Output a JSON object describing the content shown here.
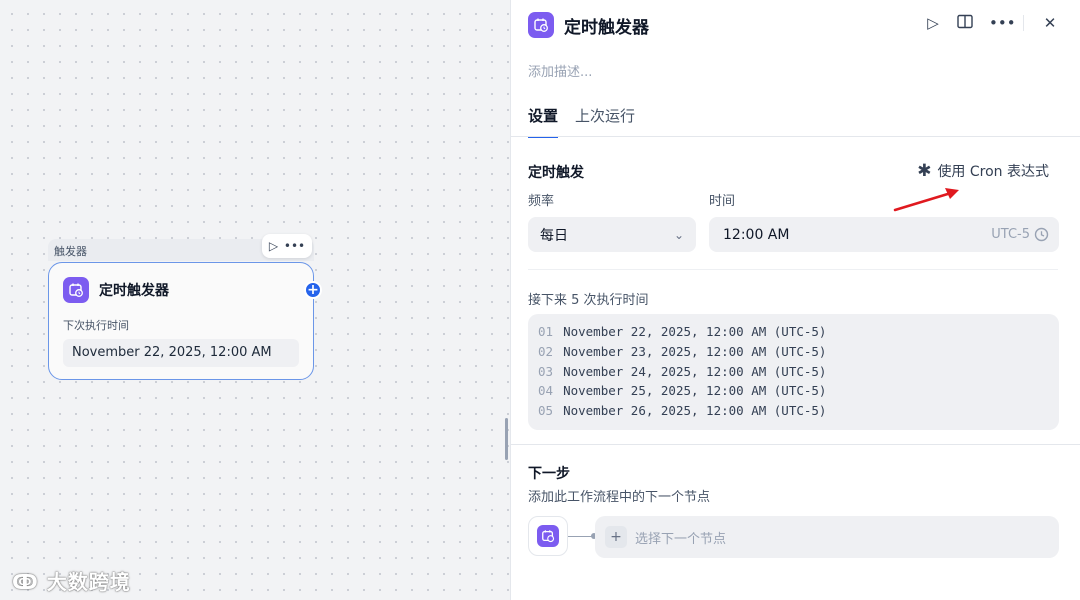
{
  "canvas": {
    "node": {
      "tag": "触发器",
      "title": "定时触发器",
      "next_run_label": "下次执行时间",
      "next_run_value": "November 22, 2025, 12:00 AM",
      "run_icon": "play-icon",
      "more_icon": "more-icon"
    },
    "watermark": "大数跨境"
  },
  "panel": {
    "title": "定时触发器",
    "description_placeholder": "添加描述...",
    "tools": [
      "play-icon",
      "book-icon",
      "more-icon",
      "close-icon"
    ],
    "tabs": [
      {
        "label": "设置",
        "active": true
      },
      {
        "label": "上次运行",
        "active": false
      }
    ],
    "schedule": {
      "title": "定时触发",
      "cron_toggle": "使用 Cron 表达式",
      "frequency_label": "频率",
      "frequency_value": "每日",
      "time_label": "时间",
      "time_value": "12:00 AM",
      "timezone": "UTC-5"
    },
    "next_runs": {
      "label": "接下来 5 次执行时间",
      "items": [
        {
          "index": "01",
          "value": "November 22, 2025, 12:00 AM (UTC-5)"
        },
        {
          "index": "02",
          "value": "November 23, 2025, 12:00 AM (UTC-5)"
        },
        {
          "index": "03",
          "value": "November 24, 2025, 12:00 AM (UTC-5)"
        },
        {
          "index": "04",
          "value": "November 25, 2025, 12:00 AM (UTC-5)"
        },
        {
          "index": "05",
          "value": "November 26, 2025, 12:00 AM (UTC-5)"
        }
      ]
    },
    "next_step": {
      "title": "下一步",
      "subtitle": "添加此工作流程中的下一个节点",
      "select_label": "选择下一个节点"
    }
  },
  "colors": {
    "accent": "#2563eb",
    "app_icon": "#7c5cf0",
    "annotation_arrow": "#e0191f"
  }
}
